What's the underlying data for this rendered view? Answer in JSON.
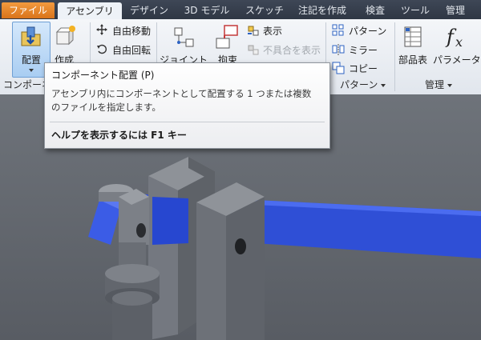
{
  "tabs": {
    "file": "ファイル",
    "assembly": "アセンブリ",
    "design": "デザイン",
    "model3d": "3D モデル",
    "sketch": "スケッチ",
    "annotate": "注記を作成",
    "inspect": "検査",
    "tools": "ツール",
    "manage": "管理"
  },
  "ribbon": {
    "place_label": "配置",
    "create_label": "作成",
    "component_panel": "コンポーネ",
    "free_move": "自由移動",
    "free_rotate": "自由回転",
    "joint_label": "ジョイント",
    "constrain_label": "拘束",
    "show_label": "表示",
    "show_sick_label": "不具合を表示",
    "pattern_label": "パターン",
    "mirror_label": "ミラー",
    "copy_label": "コピー",
    "pattern_panel": "パターン",
    "bom_label": "部品表",
    "parameters_label": "パラメータ",
    "manage_panel": "管理"
  },
  "tooltip": {
    "title": "コンポーネント配置 (P)",
    "body_line1": "アセンブリ内にコンポーネントとして配置する 1 つまたは複数",
    "body_line2": "のファイルを指定します。",
    "help": "ヘルプを表示するには F1 キー"
  },
  "colors": {
    "file_tab": "#e07f22",
    "ribbon_bg": "#e8ecf1",
    "highlight_part": "#2a4ee0",
    "viewport_bg": "#62666d"
  }
}
